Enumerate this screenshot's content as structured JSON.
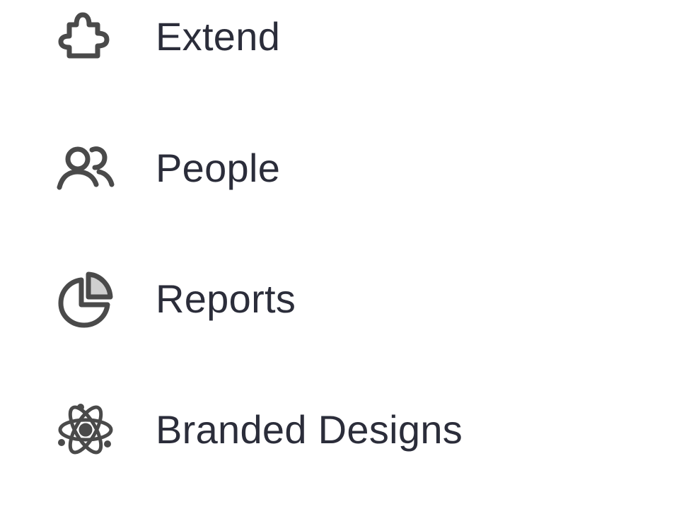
{
  "nav": {
    "items": [
      {
        "label": "Extend",
        "icon": "puzzle-icon"
      },
      {
        "label": "People",
        "icon": "people-icon"
      },
      {
        "label": "Reports",
        "icon": "pie-chart-icon"
      },
      {
        "label": "Branded Designs",
        "icon": "atom-icon"
      }
    ]
  },
  "colors": {
    "text": "#2b2d3a",
    "icon": "#4a4a4a",
    "icon_fill_light": "#cfcfcf",
    "background": "#ffffff"
  }
}
